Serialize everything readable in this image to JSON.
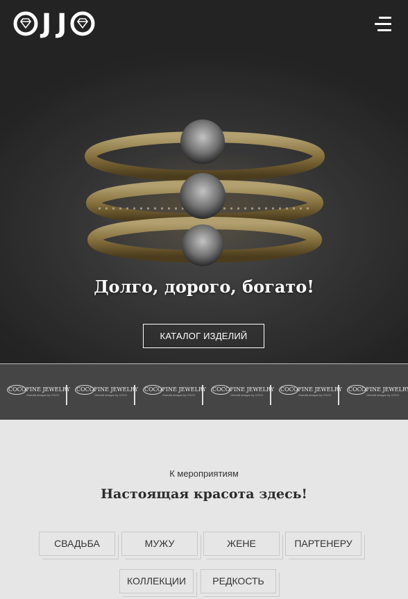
{
  "header": {
    "logo_letters": [
      "O",
      "J",
      "J",
      "O"
    ],
    "menu_icon": "hamburger-menu-icon"
  },
  "hero": {
    "title": "Долго, дорого, богато!",
    "cta_label": "КАТАЛОГ ИЗДЕЛИЙ",
    "image": "gold-diamond-rings-photo"
  },
  "brands": {
    "items": [
      {
        "name": "COCOFINE JEWELRY",
        "tagline": "Oriental designs by COCO"
      },
      {
        "name": "COCOFINE JEWELRY",
        "tagline": "Oriental designs by COCO"
      },
      {
        "name": "COCOFINE JEWELRY",
        "tagline": "Oriental designs by COCO"
      },
      {
        "name": "COCOFINE JEWELRY",
        "tagline": "Oriental designs by COCO"
      },
      {
        "name": "COCOFINE JEWELRY",
        "tagline": "Oriental designs by COCO"
      },
      {
        "name": "COCOFINE JEWELRY",
        "tagline": "Oriental designs by COCO"
      }
    ]
  },
  "events": {
    "kicker": "К мероприятиям",
    "title": "Настоящая красота здесь!",
    "tags": [
      "СВАДЬБА",
      "МУЖУ",
      "ЖЕНЕ",
      "ПАРТЕНЕРУ",
      "КОЛЛЕКЦИИ",
      "РЕДКОСТЬ"
    ]
  },
  "colors": {
    "section_bg": "#e6e6e6",
    "brand_strip_bg": "#454545",
    "hero_text": "#ffffff",
    "ring_gold": "#b59a5e"
  }
}
